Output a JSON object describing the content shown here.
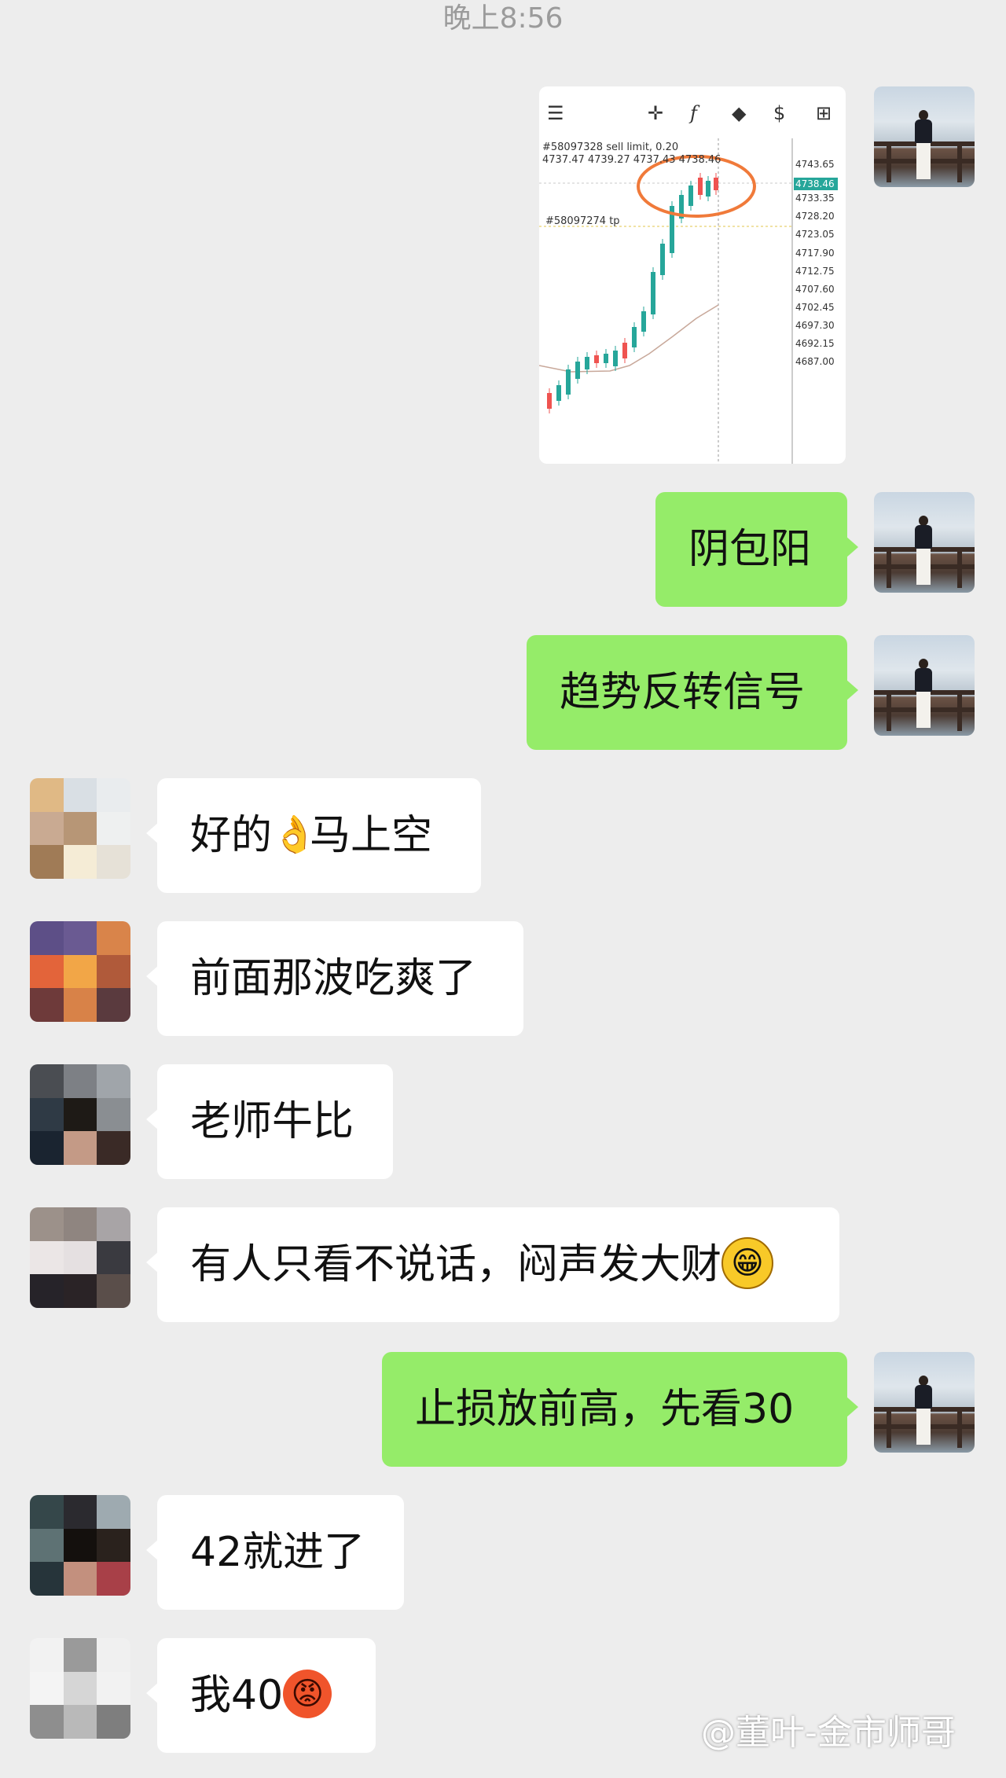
{
  "time_label": "晚上8:56",
  "chart_image": {
    "tool_icons": [
      "menu-icon",
      "crosshair-icon",
      "function-icon",
      "shapes-icon",
      "trade-icon",
      "add-object-icon"
    ],
    "order_label_1": "#58097328 sell limit, 0.20",
    "ohlc_label": "4737.47 4739.27 4737.43 4738.46",
    "order_label_2": "#58097274 tp",
    "current_price": "4738.46",
    "price_axis": [
      "4743.65",
      "4733.35",
      "4728.20",
      "4723.05",
      "4717.90",
      "4712.75",
      "4707.60",
      "4702.45",
      "4697.30",
      "4692.15",
      "4687.00"
    ],
    "colors": {
      "up": "#26a69a",
      "down": "#ef5350",
      "highlight": "#f07a3a"
    }
  },
  "messages": [
    {
      "side": "me",
      "text": "阴包阳"
    },
    {
      "side": "me",
      "text": "趋势反转信号"
    },
    {
      "side": "other",
      "text": "好的",
      "emoji": "ok-hand",
      "text2": "马上空"
    },
    {
      "side": "other",
      "text": "前面那波吃爽了"
    },
    {
      "side": "other",
      "text": "老师牛比"
    },
    {
      "side": "other",
      "text": "有人只看不说话，闷声发大财",
      "emoji": "grin"
    },
    {
      "side": "me",
      "text": "止损放前高，先看30"
    },
    {
      "side": "other",
      "text": "42就进了"
    },
    {
      "side": "other",
      "text": "我40",
      "emoji": "angry"
    }
  ],
  "watermark": "@董叶-金市师哥",
  "colors": {
    "background": "#ededed",
    "my_bubble": "#95ec69",
    "other_bubble": "#ffffff"
  }
}
